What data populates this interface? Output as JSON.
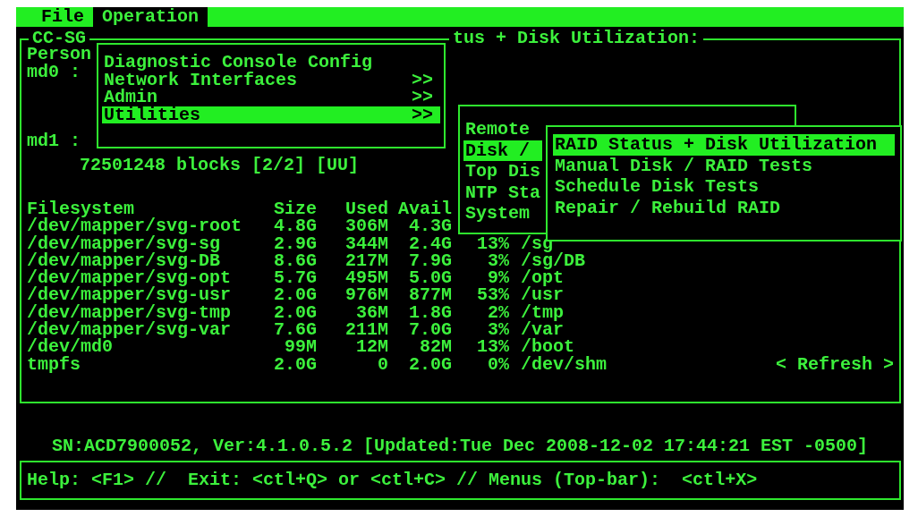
{
  "menubar": [
    {
      "label": "File",
      "selected": false
    },
    {
      "label": "Operation",
      "selected": true
    }
  ],
  "panel": {
    "title_left": "CC-SG",
    "title_right": "tus + Disk Utilization:",
    "lines": [
      {
        "kind": "label",
        "text": "Person"
      },
      {
        "kind": "label",
        "text": "md0 :"
      },
      {
        "kind": "label",
        "text": "md1 :"
      },
      {
        "kind": "detail",
        "text": "72501248 blocks [2/2] [UU]"
      }
    ],
    "table": {
      "columns": [
        "Filesystem",
        "Size",
        "Used",
        "Avail"
      ],
      "rows": [
        [
          "/dev/mapper/svg-root",
          "4.8G",
          "306M",
          "4.3G"
        ],
        [
          "/dev/mapper/svg-sg",
          "2.9G",
          "344M",
          "2.4G",
          "13%",
          "/sg"
        ],
        [
          "/dev/mapper/svg-DB",
          "8.6G",
          "217M",
          "7.9G",
          "3%",
          "/sg/DB"
        ],
        [
          "/dev/mapper/svg-opt",
          "5.7G",
          "495M",
          "5.0G",
          "9%",
          "/opt"
        ],
        [
          "/dev/mapper/svg-usr",
          "2.0G",
          "976M",
          "877M",
          "53%",
          "/usr"
        ],
        [
          "/dev/mapper/svg-tmp",
          "2.0G",
          "36M",
          "1.8G",
          "2%",
          "/tmp"
        ],
        [
          "/dev/mapper/svg-var",
          "7.6G",
          "211M",
          "7.0G",
          "3%",
          "/var"
        ],
        [
          "/dev/md0",
          "99M",
          "12M",
          "82M",
          "13%",
          "/boot"
        ],
        [
          "tmpfs",
          "2.0G",
          "0",
          "2.0G",
          "0%",
          "/dev/shm"
        ]
      ]
    },
    "refresh_button": "< Refresh >"
  },
  "operation_menu": {
    "items": [
      {
        "label": "Diagnostic Console Config",
        "selected": false
      },
      {
        "label": "Network Interfaces",
        "arrow": ">>",
        "selected": false
      },
      {
        "label": "Admin",
        "arrow": ">>",
        "selected": false
      },
      {
        "label": "Utilities",
        "arrow": ">>",
        "selected": true
      }
    ]
  },
  "utilities_menu": {
    "items": [
      {
        "label": "Remote",
        "selected": false
      },
      {
        "label": "Disk /",
        "selected": true
      },
      {
        "label": "Top Dis",
        "selected": false
      },
      {
        "label": "NTP Sta",
        "selected": false
      },
      {
        "label": "System",
        "selected": false
      }
    ]
  },
  "disk_menu": {
    "items": [
      {
        "label": "RAID Status + Disk Utilization",
        "selected": true
      },
      {
        "label": "Manual Disk / RAID Tests",
        "selected": false
      },
      {
        "label": "Schedule Disk Tests",
        "selected": false
      },
      {
        "label": "Repair / Rebuild RAID",
        "selected": false
      }
    ]
  },
  "status_line": "SN:ACD7900052, Ver:4.1.0.5.2 [Updated:Tue Dec 2008-12-02 17:44:21 EST -0500]",
  "help_bar": "Help: <F1> //  Exit: <ctl+Q> or <ctl+C> // Menus (Top-bar):  <ctl+X>"
}
